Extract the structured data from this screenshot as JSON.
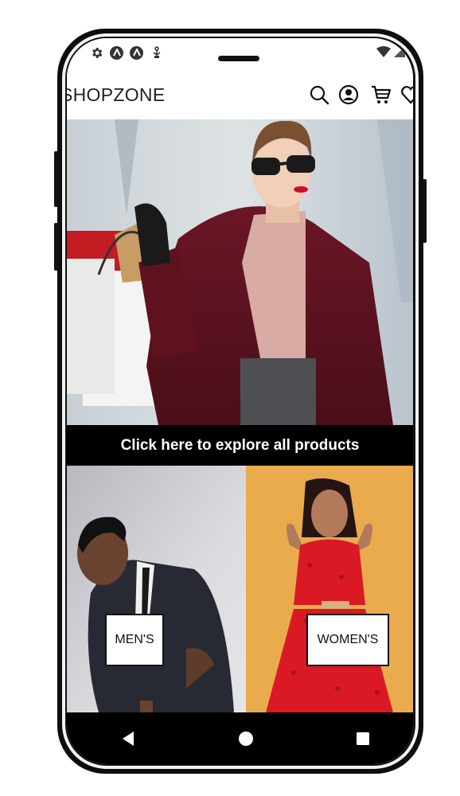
{
  "header": {
    "brand": "SHOPZONE"
  },
  "icons": {
    "search": "search-icon",
    "account": "account-icon",
    "cart": "cart-icon",
    "wishlist": "heart-icon"
  },
  "hero": {
    "cta_label": "Click here to explore all products"
  },
  "categories": [
    {
      "label": "MEN'S"
    },
    {
      "label": "WOMEN'S"
    }
  ],
  "nav": {
    "back": "back-icon",
    "home": "home-icon",
    "recents": "recents-icon"
  },
  "colors": {
    "brand_text": "#222222",
    "cta_bg": "#000000",
    "cta_text": "#ffffff",
    "women_bg": "#e9ab4e",
    "men_bg": "#cfcfd4"
  }
}
